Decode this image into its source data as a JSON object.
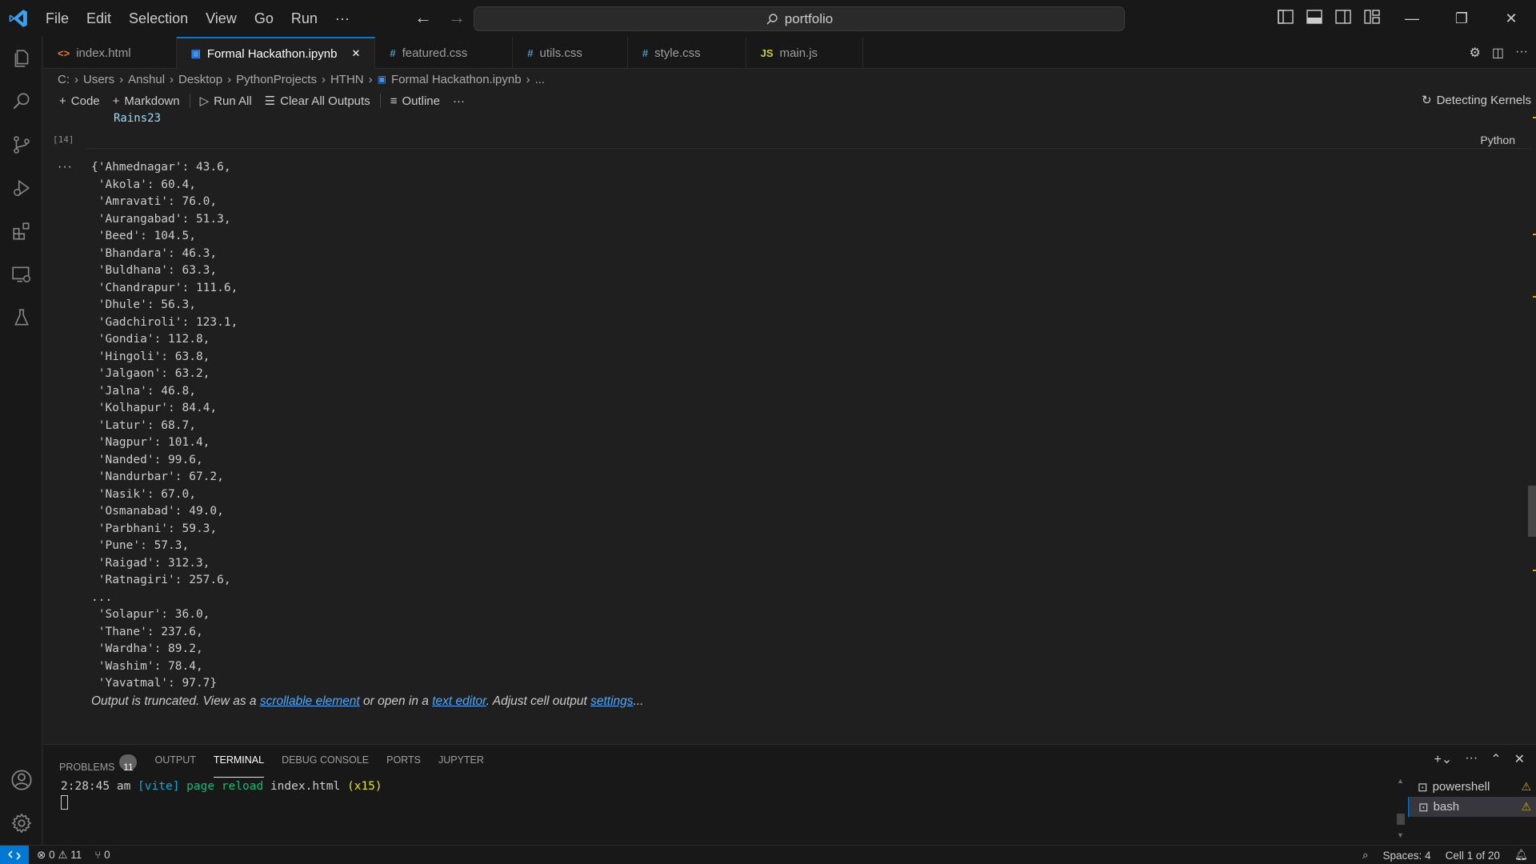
{
  "titlebar": {
    "menu": [
      "File",
      "Edit",
      "Selection",
      "View",
      "Go",
      "Run",
      "···"
    ],
    "search_text": "portfolio"
  },
  "tabs": [
    {
      "icon": "<>",
      "label": "index.html",
      "icon_color": "#e37933"
    },
    {
      "icon": "▣",
      "label": "Formal Hackathon.ipynb",
      "icon_color": "#3794ff",
      "active": true
    },
    {
      "icon": "#",
      "label": "featured.css",
      "icon_color": "#519aba"
    },
    {
      "icon": "#",
      "label": "utils.css",
      "icon_color": "#519aba"
    },
    {
      "icon": "#",
      "label": "style.css",
      "icon_color": "#519aba"
    },
    {
      "icon": "JS",
      "label": "main.js",
      "icon_color": "#cbcb41"
    }
  ],
  "breadcrumb": [
    "C:",
    "Users",
    "Anshul",
    "Desktop",
    "PythonProjects",
    "HTHN",
    "Formal Hackathon.ipynb",
    "..."
  ],
  "toolbar": {
    "code": "Code",
    "markdown": "Markdown",
    "run_all": "Run All",
    "clear_outputs": "Clear All Outputs",
    "outline": "Outline",
    "more": "···",
    "kernel_status": "Detecting Kernels"
  },
  "cell": {
    "code_line": "Rains23",
    "exec_count": "[14]",
    "language": "Python",
    "output_dots": "···"
  },
  "output_lines": [
    "{'Ahmednagar': 43.6,",
    " 'Akola': 60.4,",
    " 'Amravati': 76.0,",
    " 'Aurangabad': 51.3,",
    " 'Beed': 104.5,",
    " 'Bhandara': 46.3,",
    " 'Buldhana': 63.3,",
    " 'Chandrapur': 111.6,",
    " 'Dhule': 56.3,",
    " 'Gadchiroli': 123.1,",
    " 'Gondia': 112.8,",
    " 'Hingoli': 63.8,",
    " 'Jalgaon': 63.2,",
    " 'Jalna': 46.8,",
    " 'Kolhapur': 84.4,",
    " 'Latur': 68.7,",
    " 'Nagpur': 101.4,",
    " 'Nanded': 99.6,",
    " 'Nandurbar': 67.2,",
    " 'Nasik': 67.0,",
    " 'Osmanabad': 49.0,",
    " 'Parbhani': 59.3,",
    " 'Pune': 57.3,",
    " 'Raigad': 312.3,",
    " 'Ratnagiri': 257.6,",
    "...",
    " 'Solapur': 36.0,",
    " 'Thane': 237.6,",
    " 'Wardha': 89.2,",
    " 'Washim': 78.4,",
    " 'Yavatmal': 97.7}"
  ],
  "truncated": {
    "prefix": "Output is truncated. View as a ",
    "link1": "scrollable element",
    "mid": " or open in a ",
    "link2": "text editor",
    "mid2": ". Adjust cell output ",
    "link3": "settings",
    "suffix": "..."
  },
  "panel": {
    "tabs": [
      "PROBLEMS",
      "OUTPUT",
      "TERMINAL",
      "DEBUG CONSOLE",
      "PORTS",
      "JUPYTER"
    ],
    "problems_count": "11",
    "active_tab": "TERMINAL",
    "terminal": {
      "time": "2:28:45 am",
      "tag": "[vite]",
      "msg": "page reload",
      "file": "index.html",
      "count": "(x15)"
    },
    "terminals": [
      "powershell",
      "bash"
    ]
  },
  "statusbar": {
    "errors": "0",
    "warnings": "11",
    "ports": "0",
    "spaces": "Spaces: 4",
    "cell": "Cell 1 of 20"
  },
  "colors": {
    "accent": "#0078d4",
    "link": "#4daafc",
    "warning": "#cca700"
  }
}
